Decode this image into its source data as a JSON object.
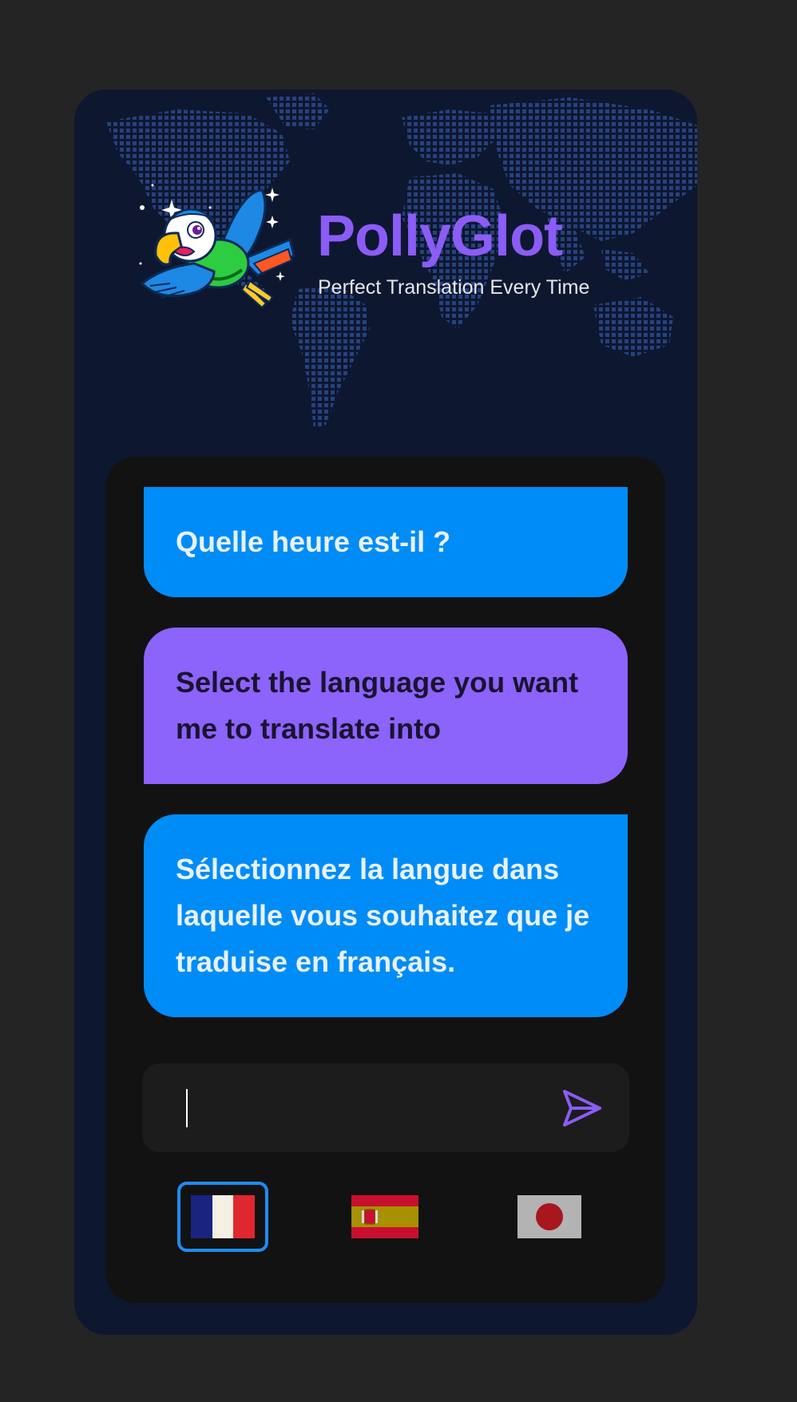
{
  "app": {
    "title": "PollyGlot",
    "subtitle": "Perfect Translation Every Time"
  },
  "chat": {
    "messages": [
      {
        "role": "user",
        "text": "Quelle heure est-il ?"
      },
      {
        "role": "assistant",
        "text": "Select the language you want me to translate into"
      },
      {
        "role": "user",
        "text": "Sélectionnez la langue dans laquelle vous souhaitez que je traduise en français."
      }
    ]
  },
  "input": {
    "value": "",
    "placeholder": ""
  },
  "languages": [
    {
      "name": "French",
      "icon": "flag-france-icon",
      "selected": true
    },
    {
      "name": "Spanish",
      "icon": "flag-spain-icon",
      "selected": false
    },
    {
      "name": "Japanese",
      "icon": "flag-japan-icon",
      "selected": false
    }
  ],
  "colors": {
    "accent": "#8b5cf6",
    "bubble_blue": "#008cf7",
    "bubble_purple": "#8c63fb",
    "selected_border": "#1d8cf5"
  },
  "icons": {
    "send": "send-icon",
    "logo": "parrot-logo-icon",
    "background": "world-map-icon"
  }
}
